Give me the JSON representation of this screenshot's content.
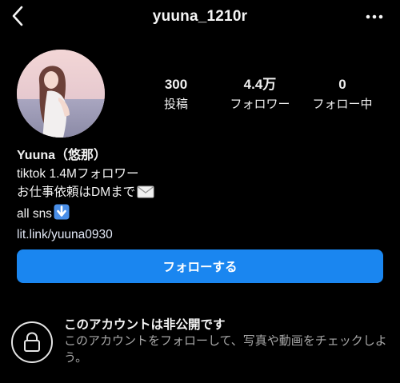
{
  "header": {
    "username": "yuuna_1210r",
    "back_icon": "chevron-left-icon",
    "more_icon": "more-dots-icon"
  },
  "profile": {
    "stats": {
      "posts": {
        "value": "300",
        "label": "投稿"
      },
      "followers": {
        "value": "4.4万",
        "label": "フォロワー"
      },
      "following": {
        "value": "0",
        "label": "フォロー中"
      }
    },
    "display_name": "Yuuna（悠那）",
    "bio_lines": [
      "tiktok 1.4Mフォロワー",
      "お仕事依頼はDMまで",
      "all sns"
    ],
    "link": "lit.link/yuuna0930"
  },
  "actions": {
    "follow_label": "フォローする"
  },
  "private_notice": {
    "title": "このアカウントは非公開です",
    "description": "このアカウントをフォローして、写真や動画をチェックしよう。"
  },
  "colors": {
    "accent": "#1a86f0",
    "background": "#000000",
    "muted_text": "#a8a8a8"
  }
}
